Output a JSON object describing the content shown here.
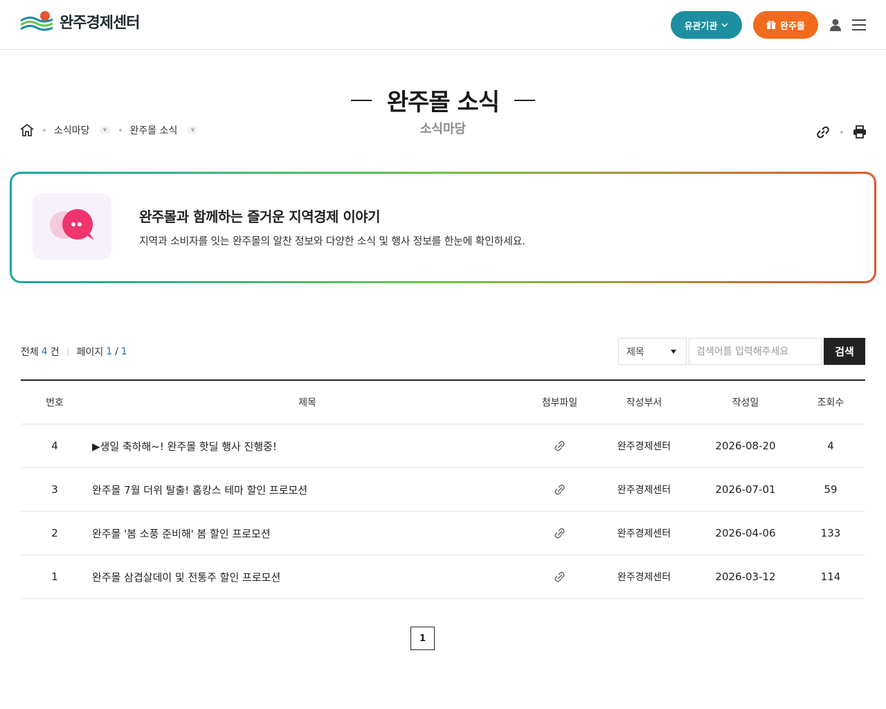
{
  "header": {
    "logo_text": "완주경제센터",
    "org_button": "유관기관",
    "mall_button": "완주몰"
  },
  "page": {
    "title": "완주몰 소식",
    "subtitle": "소식마당"
  },
  "breadcrumb": {
    "items": [
      {
        "label": "소식마당"
      },
      {
        "label": "완주몰 소식"
      }
    ]
  },
  "banner": {
    "title": "완주몰과 함께하는 즐거운 지역경제 이야기",
    "description": "지역과 소비자를 잇는 완주몰의 알찬 정보와 다양한 소식 및 행사 정보를 한눈에 확인하세요."
  },
  "board": {
    "total_label": "전체",
    "total_count": "4",
    "total_unit": "건",
    "page_label": "페이지",
    "page_current": "1",
    "page_slash": "/",
    "page_total": "1"
  },
  "search": {
    "field_selected": "제목",
    "placeholder": "검색어를 입력해주세요",
    "button": "검색"
  },
  "table": {
    "headers": {
      "no": "번호",
      "title": "제목",
      "file": "첨부파일",
      "dept": "작성부서",
      "date": "작성일",
      "views": "조회수"
    },
    "rows": [
      {
        "no": "4",
        "title": "▶생일 축하해~! 완주몰 핫딜 행사 진행중!",
        "dept": "완주경제센터",
        "date": "2026-08-20",
        "views": "4"
      },
      {
        "no": "3",
        "title": "완주몰 7월 더위 탈출! 홈캉스 테마 할인 프로모션",
        "dept": "완주경제센터",
        "date": "2026-07-01",
        "views": "59"
      },
      {
        "no": "2",
        "title": "완주몰 '봄 소풍 준비해' 봄 할인 프로모션",
        "dept": "완주경제센터",
        "date": "2026-04-06",
        "views": "133"
      },
      {
        "no": "1",
        "title": "완주몰 삼겹살데이 및 전통주 할인 프로모션",
        "dept": "완주경제센터",
        "date": "2026-03-12",
        "views": "114"
      }
    ]
  },
  "pagination": {
    "current": "1"
  },
  "colors": {
    "teal": "#1d8fa0",
    "orange": "#f26b1d",
    "link_blue": "#1d6fc4"
  }
}
